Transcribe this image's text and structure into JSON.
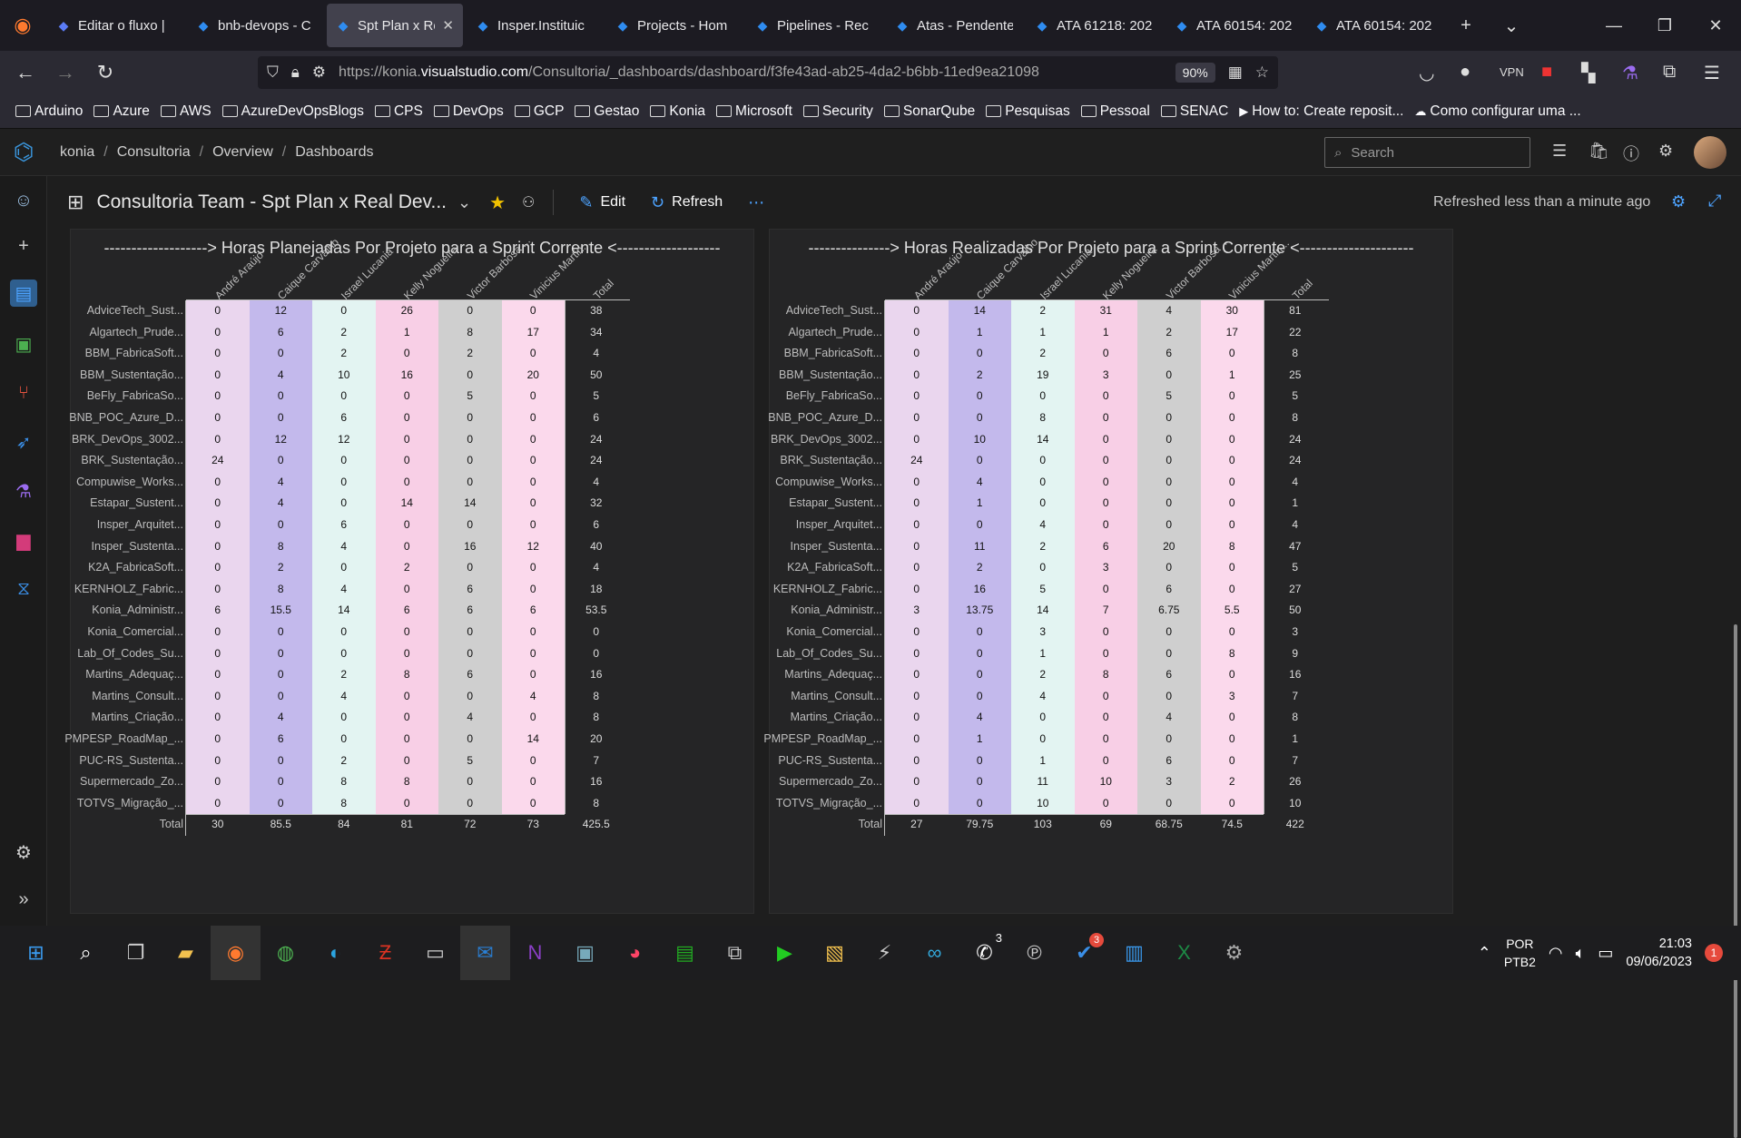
{
  "browser": {
    "tabs": [
      {
        "label": "Editar o fluxo |",
        "color": "#5b7cf6"
      },
      {
        "label": "bnb-devops - C",
        "color": "#2f8cf0"
      },
      {
        "label": "Spt Plan x Re",
        "color": "#2f8cf0",
        "active": true
      },
      {
        "label": "Insper.Instituic",
        "color": "#2f8cf0"
      },
      {
        "label": "Projects - Hom",
        "color": "#2f8cf0"
      },
      {
        "label": "Pipelines - Rec",
        "color": "#2f8cf0"
      },
      {
        "label": "Atas - Pendente",
        "color": "#2f8cf0"
      },
      {
        "label": "ATA 61218: 202",
        "color": "#2f8cf0"
      },
      {
        "label": "ATA 60154: 202",
        "color": "#2f8cf0"
      },
      {
        "label": "ATA 60154: 202",
        "color": "#2f8cf0"
      }
    ],
    "url_prefix": "https://konia.",
    "url_domain": "visualstudio.com",
    "url_path": "/Consultoria/_dashboards/dashboard/f3fe43ad-ab25-4da2-b6bb-11ed9ea21098",
    "zoom": "90%",
    "bookmarks": [
      "Arduino",
      "Azure",
      "AWS",
      "AzureDevOpsBlogs",
      "CPS",
      "DevOps",
      "GCP",
      "Gestao",
      "Konia",
      "Microsoft",
      "Security",
      "SonarQube",
      "Pesquisas",
      "Pessoal",
      "SENAC",
      "How to: Create reposit...",
      "Como configurar uma ..."
    ]
  },
  "ado": {
    "breadcrumb": [
      "konia",
      "Consultoria",
      "Overview",
      "Dashboards"
    ],
    "search_placeholder": "Search",
    "dashboard_title": "Consultoria Team - Spt Plan x Real Dev...",
    "edit_label": "Edit",
    "refresh_label": "Refresh",
    "refreshed_text": "Refreshed less than a minute ago"
  },
  "widgets": [
    {
      "title": "-------------------> Horas Planejadas Por Projeto para a Sprint Corrente <-------------------",
      "columns": [
        "André Araújo",
        "Caique Carvalho",
        "Israel Lucania",
        "Kelly Nogueira",
        "Victor Barbosa ...",
        "Vinicius Martin...",
        "Total"
      ],
      "col_colors": [
        "#ead6ee",
        "#c3b9ec",
        "#e3f4f2",
        "#f8cfe6",
        "#cfcfcf",
        "#fbd9ec"
      ],
      "rows": [
        {
          "label": "AdviceTech_Sust...",
          "values": [
            "0",
            "12",
            "0",
            "26",
            "0",
            "0"
          ],
          "total": "38"
        },
        {
          "label": "Algartech_Prude...",
          "values": [
            "0",
            "6",
            "2",
            "1",
            "8",
            "17"
          ],
          "total": "34"
        },
        {
          "label": "BBM_FabricaSoft...",
          "values": [
            "0",
            "0",
            "2",
            "0",
            "2",
            "0"
          ],
          "total": "4"
        },
        {
          "label": "BBM_Sustentação...",
          "values": [
            "0",
            "4",
            "10",
            "16",
            "0",
            "20"
          ],
          "total": "50"
        },
        {
          "label": "BeFly_FabricaSo...",
          "values": [
            "0",
            "0",
            "0",
            "0",
            "5",
            "0"
          ],
          "total": "5"
        },
        {
          "label": "BNB_POC_Azure_D...",
          "values": [
            "0",
            "0",
            "6",
            "0",
            "0",
            "0"
          ],
          "total": "6"
        },
        {
          "label": "BRK_DevOps_3002...",
          "values": [
            "0",
            "12",
            "12",
            "0",
            "0",
            "0"
          ],
          "total": "24"
        },
        {
          "label": "BRK_Sustentação...",
          "values": [
            "24",
            "0",
            "0",
            "0",
            "0",
            "0"
          ],
          "total": "24"
        },
        {
          "label": "Compuwise_Works...",
          "values": [
            "0",
            "4",
            "0",
            "0",
            "0",
            "0"
          ],
          "total": "4"
        },
        {
          "label": "Estapar_Sustent...",
          "values": [
            "0",
            "4",
            "0",
            "14",
            "14",
            "0"
          ],
          "total": "32"
        },
        {
          "label": "Insper_Arquitet...",
          "values": [
            "0",
            "0",
            "6",
            "0",
            "0",
            "0"
          ],
          "total": "6"
        },
        {
          "label": "Insper_Sustenta...",
          "values": [
            "0",
            "8",
            "4",
            "0",
            "16",
            "12"
          ],
          "total": "40"
        },
        {
          "label": "K2A_FabricaSoft...",
          "values": [
            "0",
            "2",
            "0",
            "2",
            "0",
            "0"
          ],
          "total": "4"
        },
        {
          "label": "KERNHOLZ_Fabric...",
          "values": [
            "0",
            "8",
            "4",
            "0",
            "6",
            "0"
          ],
          "total": "18"
        },
        {
          "label": "Konia_Administr...",
          "values": [
            "6",
            "15.5",
            "14",
            "6",
            "6",
            "6"
          ],
          "total": "53.5"
        },
        {
          "label": "Konia_Comercial...",
          "values": [
            "0",
            "0",
            "0",
            "0",
            "0",
            "0"
          ],
          "total": "0"
        },
        {
          "label": "Lab_Of_Codes_Su...",
          "values": [
            "0",
            "0",
            "0",
            "0",
            "0",
            "0"
          ],
          "total": "0"
        },
        {
          "label": "Martins_Adequaç...",
          "values": [
            "0",
            "0",
            "2",
            "8",
            "6",
            "0"
          ],
          "total": "16"
        },
        {
          "label": "Martins_Consult...",
          "values": [
            "0",
            "0",
            "4",
            "0",
            "0",
            "4"
          ],
          "total": "8"
        },
        {
          "label": "Martins_Criação...",
          "values": [
            "0",
            "4",
            "0",
            "0",
            "4",
            "0"
          ],
          "total": "8"
        },
        {
          "label": "PMPESP_RoadMap_...",
          "values": [
            "0",
            "6",
            "0",
            "0",
            "0",
            "14"
          ],
          "total": "20"
        },
        {
          "label": "PUC-RS_Sustenta...",
          "values": [
            "0",
            "0",
            "2",
            "0",
            "5",
            "0"
          ],
          "total": "7"
        },
        {
          "label": "Supermercado_Zo...",
          "values": [
            "0",
            "0",
            "8",
            "8",
            "0",
            "0"
          ],
          "total": "16"
        },
        {
          "label": "TOTVS_Migração_...",
          "values": [
            "0",
            "0",
            "8",
            "0",
            "0",
            "0"
          ],
          "total": "8"
        }
      ],
      "total_label": "Total",
      "totals": [
        "30",
        "85.5",
        "84",
        "81",
        "72",
        "73",
        "425.5"
      ]
    },
    {
      "title": "---------------> Horas Realizadas Por Projeto para a Sprint Corrente <---------------------",
      "columns": [
        "André Araújo",
        "Caique Carvalho",
        "Israel Lucania",
        "Kelly Nogueira",
        "Victor Barbosa ...",
        "Vinicius Martin...",
        "Total"
      ],
      "col_colors": [
        "#ead6ee",
        "#c3b9ec",
        "#e3f4f2",
        "#f8cfe6",
        "#cfcfcf",
        "#fbd9ec"
      ],
      "rows": [
        {
          "label": "AdviceTech_Sust...",
          "values": [
            "0",
            "14",
            "2",
            "31",
            "4",
            "30"
          ],
          "total": "81"
        },
        {
          "label": "Algartech_Prude...",
          "values": [
            "0",
            "1",
            "1",
            "1",
            "2",
            "17"
          ],
          "total": "22"
        },
        {
          "label": "BBM_FabricaSoft...",
          "values": [
            "0",
            "0",
            "2",
            "0",
            "6",
            "0"
          ],
          "total": "8"
        },
        {
          "label": "BBM_Sustentação...",
          "values": [
            "0",
            "2",
            "19",
            "3",
            "0",
            "1"
          ],
          "total": "25"
        },
        {
          "label": "BeFly_FabricaSo...",
          "values": [
            "0",
            "0",
            "0",
            "0",
            "5",
            "0"
          ],
          "total": "5"
        },
        {
          "label": "BNB_POC_Azure_D...",
          "values": [
            "0",
            "0",
            "8",
            "0",
            "0",
            "0"
          ],
          "total": "8"
        },
        {
          "label": "BRK_DevOps_3002...",
          "values": [
            "0",
            "10",
            "14",
            "0",
            "0",
            "0"
          ],
          "total": "24"
        },
        {
          "label": "BRK_Sustentação...",
          "values": [
            "24",
            "0",
            "0",
            "0",
            "0",
            "0"
          ],
          "total": "24"
        },
        {
          "label": "Compuwise_Works...",
          "values": [
            "0",
            "4",
            "0",
            "0",
            "0",
            "0"
          ],
          "total": "4"
        },
        {
          "label": "Estapar_Sustent...",
          "values": [
            "0",
            "1",
            "0",
            "0",
            "0",
            "0"
          ],
          "total": "1"
        },
        {
          "label": "Insper_Arquitet...",
          "values": [
            "0",
            "0",
            "4",
            "0",
            "0",
            "0"
          ],
          "total": "4"
        },
        {
          "label": "Insper_Sustenta...",
          "values": [
            "0",
            "11",
            "2",
            "6",
            "20",
            "8"
          ],
          "total": "47"
        },
        {
          "label": "K2A_FabricaSoft...",
          "values": [
            "0",
            "2",
            "0",
            "3",
            "0",
            "0"
          ],
          "total": "5"
        },
        {
          "label": "KERNHOLZ_Fabric...",
          "values": [
            "0",
            "16",
            "5",
            "0",
            "6",
            "0"
          ],
          "total": "27"
        },
        {
          "label": "Konia_Administr...",
          "values": [
            "3",
            "13.75",
            "14",
            "7",
            "6.75",
            "5.5"
          ],
          "total": "50"
        },
        {
          "label": "Konia_Comercial...",
          "values": [
            "0",
            "0",
            "3",
            "0",
            "0",
            "0"
          ],
          "total": "3"
        },
        {
          "label": "Lab_Of_Codes_Su...",
          "values": [
            "0",
            "0",
            "1",
            "0",
            "0",
            "8"
          ],
          "total": "9"
        },
        {
          "label": "Martins_Adequaç...",
          "values": [
            "0",
            "0",
            "2",
            "8",
            "6",
            "0"
          ],
          "total": "16"
        },
        {
          "label": "Martins_Consult...",
          "values": [
            "0",
            "0",
            "4",
            "0",
            "0",
            "3"
          ],
          "total": "7"
        },
        {
          "label": "Martins_Criação...",
          "values": [
            "0",
            "4",
            "0",
            "0",
            "4",
            "0"
          ],
          "total": "8"
        },
        {
          "label": "PMPESP_RoadMap_...",
          "values": [
            "0",
            "1",
            "0",
            "0",
            "0",
            "0"
          ],
          "total": "1"
        },
        {
          "label": "PUC-RS_Sustenta...",
          "values": [
            "0",
            "0",
            "1",
            "0",
            "6",
            "0"
          ],
          "total": "7"
        },
        {
          "label": "Supermercado_Zo...",
          "values": [
            "0",
            "0",
            "11",
            "10",
            "3",
            "2"
          ],
          "total": "26"
        },
        {
          "label": "TOTVS_Migração_...",
          "values": [
            "0",
            "0",
            "10",
            "0",
            "0",
            "0"
          ],
          "total": "10"
        }
      ],
      "total_label": "Total",
      "totals": [
        "27",
        "79.75",
        "103",
        "69",
        "68.75",
        "74.5",
        "422"
      ]
    }
  ],
  "taskbar": {
    "lang_line1": "POR",
    "lang_line2": "PTB2",
    "time": "21:03",
    "date": "09/06/2023",
    "notification_count": "1",
    "whatsapp_badge": "3",
    "todo_badge": "3"
  }
}
